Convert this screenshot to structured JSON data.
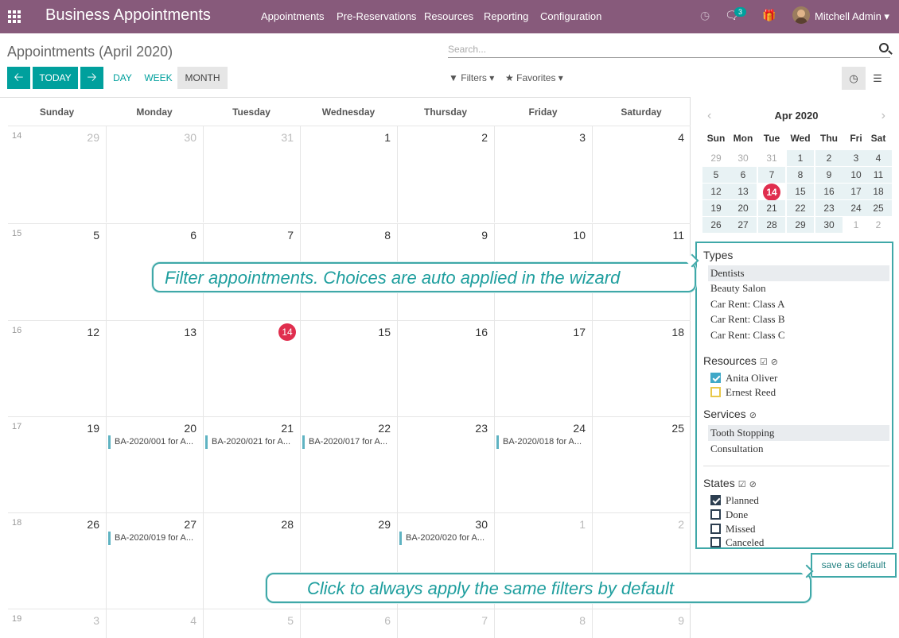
{
  "app": {
    "title": "Business Appointments",
    "menu": [
      "Appointments",
      "Pre-Reservations",
      "Resources",
      "Reporting",
      "Configuration"
    ],
    "message_count": "3",
    "user": "Mitchell Admin",
    "icons": [
      "apps-icon",
      "clock-icon",
      "chat-icon",
      "gift-icon",
      "avatar"
    ]
  },
  "control": {
    "breadcrumb": "Appointments (April 2020)",
    "search_placeholder": "Search...",
    "today_label": "TODAY",
    "day_label": "DAY",
    "week_label": "WEEK",
    "month_label": "MONTH",
    "filters_label": "Filters",
    "favorites_label": "Favorites"
  },
  "calendar": {
    "day_headers": [
      "Sunday",
      "Monday",
      "Tuesday",
      "Wednesday",
      "Thursday",
      "Friday",
      "Saturday"
    ],
    "weeks": [
      {
        "week": "14",
        "days": [
          [
            "29",
            true
          ],
          [
            "30",
            true
          ],
          [
            "31",
            true
          ],
          [
            "1",
            false
          ],
          [
            "2",
            false
          ],
          [
            "3",
            false
          ],
          [
            "4",
            false
          ]
        ]
      },
      {
        "week": "15",
        "days": [
          [
            "5",
            false
          ],
          [
            "6",
            false
          ],
          [
            "7",
            false
          ],
          [
            "8",
            false
          ],
          [
            "9",
            false
          ],
          [
            "10",
            false
          ],
          [
            "11",
            false
          ]
        ]
      },
      {
        "week": "16",
        "days": [
          [
            "12",
            false
          ],
          [
            "13",
            false
          ],
          [
            "14",
            false
          ],
          [
            "15",
            false
          ],
          [
            "16",
            false
          ],
          [
            "17",
            false
          ],
          [
            "18",
            false
          ]
        ]
      },
      {
        "week": "17",
        "days": [
          [
            "19",
            false
          ],
          [
            "20",
            false
          ],
          [
            "21",
            false
          ],
          [
            "22",
            false
          ],
          [
            "23",
            false
          ],
          [
            "24",
            false
          ],
          [
            "25",
            false
          ]
        ]
      },
      {
        "week": "18",
        "days": [
          [
            "26",
            false
          ],
          [
            "27",
            false
          ],
          [
            "28",
            false
          ],
          [
            "29",
            false
          ],
          [
            "30",
            false
          ],
          [
            "1",
            true
          ],
          [
            "2",
            true
          ]
        ]
      },
      {
        "week": "19",
        "days": [
          [
            "3",
            true
          ],
          [
            "4",
            true
          ],
          [
            "5",
            true
          ],
          [
            "6",
            true
          ],
          [
            "7",
            true
          ],
          [
            "8",
            true
          ],
          [
            "9",
            true
          ]
        ]
      }
    ],
    "today": "14",
    "events": [
      {
        "label": "BA-2020/001 for A...",
        "week": 3,
        "day": 1
      },
      {
        "label": "BA-2020/021 for A...",
        "week": 3,
        "day": 2
      },
      {
        "label": "BA-2020/017 for A...",
        "week": 3,
        "day": 3
      },
      {
        "label": "BA-2020/018 for A...",
        "week": 3,
        "day": 5
      },
      {
        "label": "BA-2020/019 for A...",
        "week": 4,
        "day": 1
      },
      {
        "label": "BA-2020/020 for A...",
        "week": 4,
        "day": 4
      }
    ]
  },
  "mini_calendar": {
    "title": "Apr 2020",
    "headers": [
      "Sun",
      "Mon",
      "Tue",
      "Wed",
      "Thu",
      "Fri",
      "Sat"
    ],
    "rows": [
      [
        "29",
        "30",
        "31",
        "1",
        "2",
        "3",
        "4"
      ],
      [
        "5",
        "6",
        "7",
        "8",
        "9",
        "10",
        "11"
      ],
      [
        "12",
        "13",
        "14",
        "15",
        "16",
        "17",
        "18"
      ],
      [
        "19",
        "20",
        "21",
        "22",
        "23",
        "24",
        "25"
      ],
      [
        "26",
        "27",
        "28",
        "29",
        "30",
        "1",
        "2"
      ]
    ],
    "today": "14"
  },
  "filters": {
    "types_title": "Types",
    "types": [
      "Dentists",
      "Beauty Salon",
      "Car Rent: Class A",
      "Car Rent: Class B",
      "Car Rent: Class C"
    ],
    "resources_title": "Resources",
    "resources": [
      {
        "label": "Anita Oliver",
        "checked": true
      },
      {
        "label": "Ernest Reed",
        "checked": false
      }
    ],
    "services_title": "Services",
    "services": [
      "Tooth Stopping",
      "Consultation"
    ],
    "states_title": "States",
    "states": [
      {
        "label": "Planned",
        "checked": true
      },
      {
        "label": "Done",
        "checked": false
      },
      {
        "label": "Missed",
        "checked": false
      },
      {
        "label": "Canceled",
        "checked": false
      }
    ],
    "save_default": "save as default"
  },
  "tooltips": {
    "filter_tip": "Filter appointments. Choices are auto applied in the wizard",
    "default_tip": "Click to always apply the same filters by default"
  },
  "colors": {
    "brand": "#875a7b",
    "accent": "#00a09d",
    "today": "#e02e4e",
    "highlight": "#3fa8a8"
  }
}
